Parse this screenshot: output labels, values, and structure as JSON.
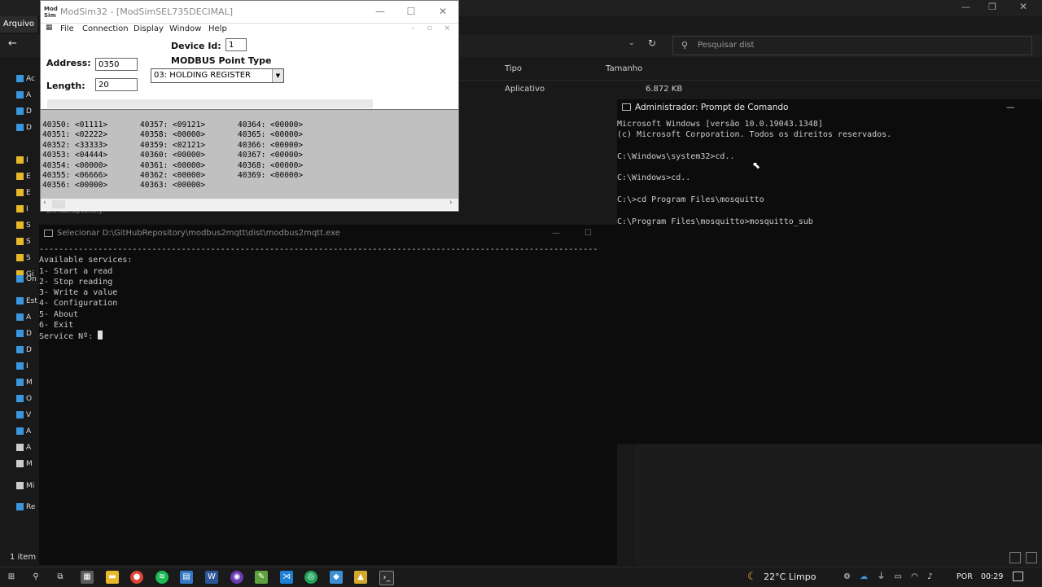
{
  "explorer": {
    "menu_label": "Arquivo",
    "search_placeholder": "Pesquisar dist",
    "columns": [
      "Tipo",
      "Tamanho"
    ],
    "row": {
      "type": "Aplicativo",
      "size": "6.872 KB"
    },
    "nav_items": [
      "Ac",
      "A",
      "D",
      "D",
      "I",
      "E",
      "E",
      "I",
      "Gi",
      "S",
      "S",
      "S",
      "On",
      "Esta",
      "A",
      "D",
      "D",
      "I",
      "M",
      "O",
      "V",
      "A",
      "A",
      "M",
      "Mi",
      "Re"
    ],
    "nav_hint": "GitHubRepository",
    "status": "1 item"
  },
  "modsim": {
    "title": "ModSim32 - [ModSimSEL735DECIMAL]",
    "logo_text": "Mod Sim",
    "menu": [
      "File",
      "Connection",
      "Display",
      "Window",
      "Help"
    ],
    "device_id_label": "Device Id:",
    "device_id": "1",
    "point_type_label": "MODBUS Point Type",
    "address_label": "Address:",
    "address": "0350",
    "length_label": "Length:",
    "length": "20",
    "point_type": "03: HOLDING REGISTER",
    "registers": [
      [
        "40350: <01111>",
        "40351: <02222>",
        "40352: <33333>",
        "40353: <04444>",
        "40354: <00000>",
        "40355: <06666>",
        "40356: <00000>"
      ],
      [
        "40357: <09121>",
        "40358: <00000>",
        "40359: <02121>",
        "40360: <00000>",
        "40361: <00000>",
        "40362: <00000>",
        "40363: <00000>"
      ],
      [
        "40364: <00000>",
        "40365: <00000>",
        "40366: <00000>",
        "40367: <00000>",
        "40368: <00000>",
        "40369: <00000>"
      ]
    ]
  },
  "console2": {
    "title": "Selecionar D:\\GitHubRepository\\modbus2mqtt\\dist\\modbus2mqtt.exe",
    "separator": "------------------------------------------------------------------------------------------------------------------",
    "lines": [
      "Available services:",
      "1- Start a read",
      "2- Stop reading",
      "3- Write a value",
      "4- Configuration",
      "5- About",
      "6- Exit"
    ],
    "prompt": "Service Nº: "
  },
  "cmd": {
    "title": "Administrador: Prompt de Comando",
    "lines": [
      "Microsoft Windows [versão 10.0.19043.1348]",
      "(c) Microsoft Corporation. Todos os direitos reservados.",
      "",
      "C:\\Windows\\system32>cd..",
      "",
      "C:\\Windows>cd..",
      "",
      "C:\\>cd Program Files\\mosquitto",
      "",
      "C:\\Program Files\\mosquitto>mosquitto_sub"
    ]
  },
  "taskbar": {
    "apps": [
      "file-explorer",
      "chrome",
      "spotify",
      "edge",
      "word",
      "app",
      "notepad",
      "vscode",
      "app2",
      "app3",
      "app4",
      "terminal"
    ],
    "weather": "22°C Limpo",
    "lang": "POR",
    "time": "00:29"
  }
}
